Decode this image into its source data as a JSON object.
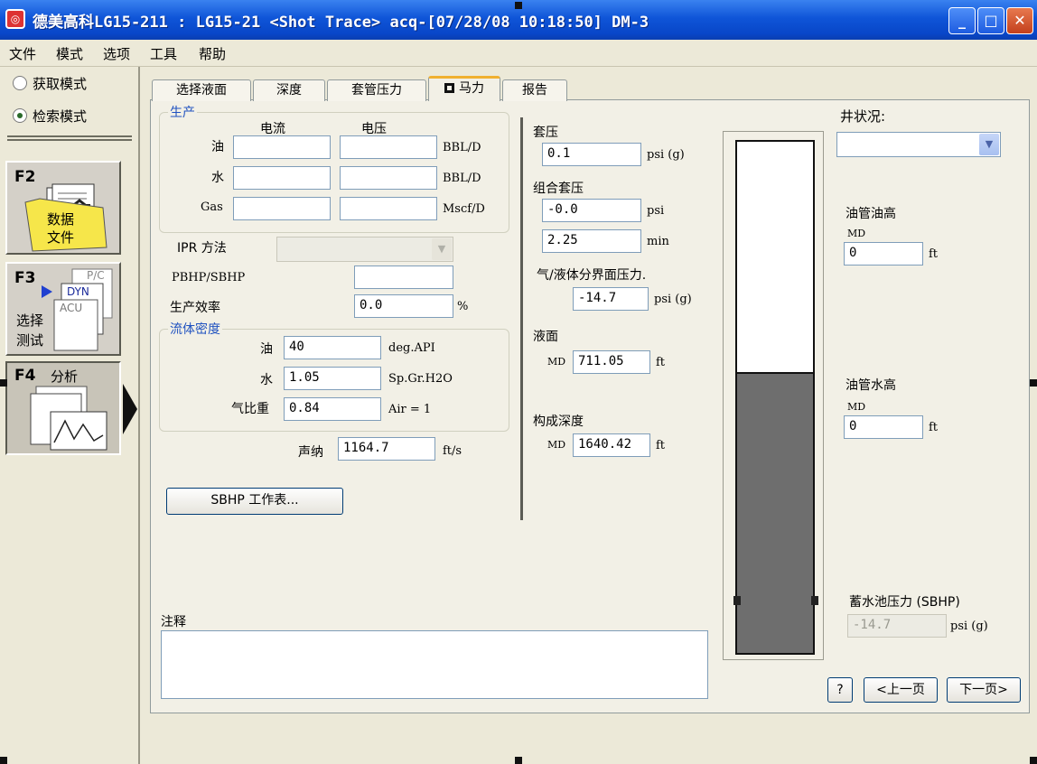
{
  "window": {
    "title": "德美高科LG15-211 : LG15-21  <Shot Trace>  acq-[07/28/08 10:18:50]  DM-3",
    "icon_name": "app-logo-icon",
    "controls": [
      "minimize-icon",
      "maximize-icon",
      "close-icon"
    ]
  },
  "menubar": {
    "items": [
      "文件",
      "模式",
      "选项",
      "工具",
      "帮助"
    ]
  },
  "sidebar": {
    "mode_acquire": "获取模式",
    "mode_retrieve": "检索模式",
    "selected_mode": "检索模式",
    "fkeys": [
      {
        "key": "F2",
        "label_line1": "数据",
        "label_line2": "文件"
      },
      {
        "key": "F3",
        "label_line1": "选择",
        "label_line2": "测试",
        "docs": [
          "P/C",
          "DYN",
          "ACU"
        ]
      },
      {
        "key": "F4",
        "label_line1": "分析"
      }
    ]
  },
  "tabs": {
    "items": [
      "选择液面",
      "深度",
      "套管压力",
      "马力",
      "报告"
    ],
    "active": "马力"
  },
  "production": {
    "group_title": "生产",
    "col_current": "电流",
    "col_voltage": "电压",
    "rows": [
      {
        "label": "油",
        "current": "",
        "voltage": "",
        "unit": "BBL/D"
      },
      {
        "label": "水",
        "current": "",
        "voltage": "",
        "unit": "BBL/D"
      },
      {
        "label": "Gas",
        "current": "",
        "voltage": "",
        "unit": "Mscf/D"
      }
    ]
  },
  "ipr": {
    "method_label": "IPR 方法",
    "method_value": "",
    "pbhp_label": "PBHP/SBHP",
    "pbhp_value": "",
    "efficiency_label": "生产效率",
    "efficiency_value": "0.0",
    "efficiency_unit": "%"
  },
  "fluid": {
    "group_title": "流体密度",
    "oil_label": "油",
    "oil_value": "40",
    "oil_unit": "deg.API",
    "water_label": "水",
    "water_value": "1.05",
    "water_unit": "Sp.Gr.H2O",
    "gas_label": "气比重",
    "gas_value": "0.84",
    "gas_unit": "Air = 1"
  },
  "acoustic": {
    "label": "声纳",
    "value": "1164.7",
    "unit": "ft/s"
  },
  "sbhp_button": "SBHP 工作表...",
  "notes": {
    "label": "注释",
    "value": ""
  },
  "casing": {
    "pressure_label": "套压",
    "pressure_value": "0.1",
    "pressure_unit": "psi (g)",
    "combined_label": "组合套压",
    "combined_value": "-0.0",
    "combined_unit": "psi",
    "time_value": "2.25",
    "time_unit": "min",
    "interface_label": "气/液体分界面压力.",
    "interface_value": "-14.7",
    "interface_unit": "psi (g)",
    "liquid_label": "液面",
    "liquid_md": "MD",
    "liquid_value": "711.05",
    "liquid_unit": "ft",
    "formation_label": "构成深度",
    "formation_md": "MD",
    "formation_value": "1640.42",
    "formation_unit": "ft"
  },
  "well": {
    "status_label": "井状况:",
    "status_value": "",
    "tubing_oil_label": "油管油高",
    "tubing_oil_md": "MD",
    "tubing_oil_value": "0",
    "tubing_oil_unit": "ft",
    "tubing_water_label": "油管水高",
    "tubing_water_md": "MD",
    "tubing_water_value": "0",
    "tubing_water_unit": "ft",
    "sbhp_label": "蓄水池压力 (SBHP)",
    "sbhp_value": "-14.7",
    "sbhp_unit": "psi (g)",
    "liquid_fill_fraction": 0.55
  },
  "nav": {
    "help": "?",
    "prev": "<上一页",
    "next": "下一页>"
  }
}
